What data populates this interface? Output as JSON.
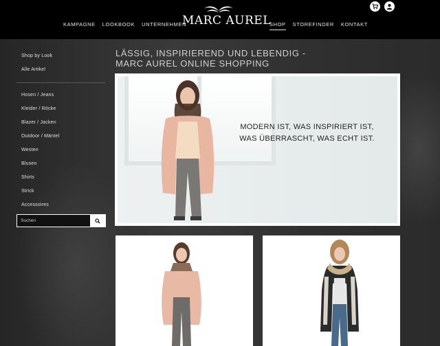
{
  "header": {
    "nav_left": [
      "KAMPAGNE",
      "LOOKBOOK",
      "UNTERNEHMEN"
    ],
    "nav_right": [
      "SHOP",
      "STOREFINDER",
      "KONTAKT"
    ],
    "active_nav": "SHOP",
    "logo_text": "MARC AUREL",
    "icons": [
      "cart-icon",
      "user-icon"
    ]
  },
  "sidebar": {
    "group1": [
      "Shop by Look",
      "Alle Artikel"
    ],
    "group2": [
      "Hosen / Jeans",
      "Kleider / Röcke",
      "Blazer / Jacken",
      "Outdoor / Mäntel",
      "Westen",
      "Blusen",
      "Shirts",
      "Strick",
      "Accessoires"
    ]
  },
  "search": {
    "placeholder": "Suchen",
    "icon": "search-icon"
  },
  "main": {
    "title_line1": "LÄSSIG, INSPIRIEREND UND LEBENDIG -",
    "title_line2": "MARC AUREL ONLINE SHOPPING",
    "hero_line1": "MODERN IST, WAS INSPIRIERT IST,",
    "hero_line2": "WAS ÜBERRASCHT, WAS ECHT IST."
  },
  "colors": {
    "header_bg": "#000000",
    "page_bg": "#2a2a2a",
    "text_light": "#e0e0e0"
  }
}
